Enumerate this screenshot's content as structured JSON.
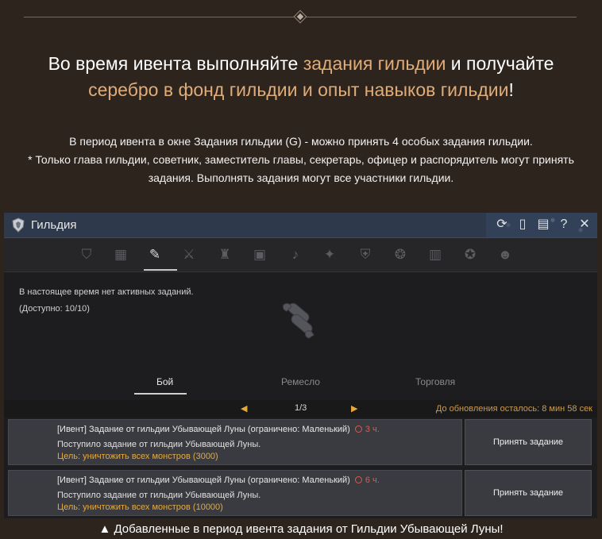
{
  "headline": {
    "part1": "Во время ивента выполняйте ",
    "part2": "задания гильдии",
    "part3": " и получайте",
    "part4": "серебро в фонд гильдии и опыт навыков гильдии",
    "part5": "!"
  },
  "description": {
    "line1": "В период ивента в окне Задания гильдии (G) - можно принять 4 особых задания гильдии.",
    "line2": "* Только глава гильдии, советник, заместитель главы, секретарь, офицер и распорядитель могут принять",
    "line3": "задания. Выполнять задания могут все участники гильдии."
  },
  "window": {
    "title": "Гильдия",
    "titlebar_icons": [
      "refresh-icon",
      "phone-icon",
      "document-icon",
      "help-icon",
      "close-icon"
    ],
    "tabs": [
      "guild-crest-icon",
      "guild-notice-icon",
      "guild-quest-icon",
      "guild-war-icon",
      "guild-tower-icon",
      "guild-book-icon",
      "guild-bell-icon",
      "guild-eagle-icon",
      "guild-shield-icon",
      "guild-emblem-icon",
      "guild-contract-icon",
      "guild-badge-icon",
      "guild-mask-icon"
    ],
    "active_tab": 2,
    "no_active_text": "В настоящее время нет активных заданий.",
    "available_text": "(Доступно: 10/10)",
    "subtabs": [
      "Бой",
      "Ремесло",
      "Торговля"
    ],
    "active_subtab": 0,
    "page": "1/3",
    "refresh_text": "До обновления осталось: 8 мин 58 сек",
    "quests": [
      {
        "title": "[Ивент] Задание от гильдии Убывающей Луны (ограничено: Маленький)",
        "time": "3 ч.",
        "desc": "Поступило задание от гильдии Убывающей Луны.",
        "goal": "Цель: уничтожить всех монстров (3000)",
        "button": "Принять задание"
      },
      {
        "title": "[Ивент] Задание от гильдии Убывающей Луны (ограничено: Маленький)",
        "time": "6 ч.",
        "desc": "Поступило задание от гильдии Убывающей Луны.",
        "goal": "Цель: уничтожить всех монстров (10000)",
        "button": "Принять задание"
      }
    ]
  },
  "caption": "▲ Добавленные в период ивента задания от Гильдии Убывающей Луны!",
  "colors": {
    "background": "#2d241e",
    "highlight": "#e0ac78",
    "goal": "#e6a93c",
    "timer": "#e05a48"
  }
}
